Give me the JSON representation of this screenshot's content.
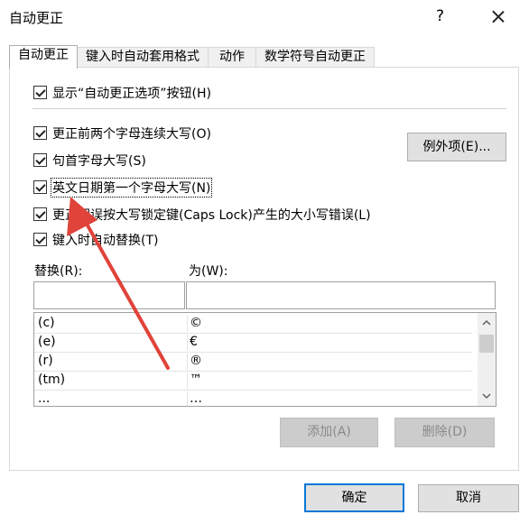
{
  "window": {
    "title": "自动更正",
    "help": "?"
  },
  "tabs": [
    {
      "label": "自动更正"
    },
    {
      "label": "键入时自动套用格式"
    },
    {
      "label": "动作"
    },
    {
      "label": "数学符号自动更正"
    }
  ],
  "options": {
    "show_buttons": "显示“自动更正选项”按钮(H)",
    "two_initial_caps": "更正前两个字母连续大写(O)",
    "first_letter_sentence": "句首字母大写(S)",
    "first_letter_days": "英文日期第一个字母大写(N)",
    "caps_lock": "更正因误按大写锁定键(Caps Lock)产生的大小写错误(L)",
    "replace_as_type": "键入时自动替换(T)"
  },
  "buttons": {
    "exceptions": "例外项(E)...",
    "add": "添加(A)",
    "delete": "删除(D)",
    "ok": "确定",
    "cancel": "取消"
  },
  "fields": {
    "replace_label": "替换(R):",
    "with_label": "为(W):",
    "replace_value": "",
    "with_value": ""
  },
  "list": [
    {
      "replace": "(c)",
      "with": "©"
    },
    {
      "replace": "(e)",
      "with": "€"
    },
    {
      "replace": "(r)",
      "with": "®"
    },
    {
      "replace": "(tm)",
      "with": "™"
    },
    {
      "replace": "...",
      "with": "…"
    }
  ],
  "colors": {
    "annotation_arrow": "#e0433a",
    "focus_border": "#0078d7"
  }
}
